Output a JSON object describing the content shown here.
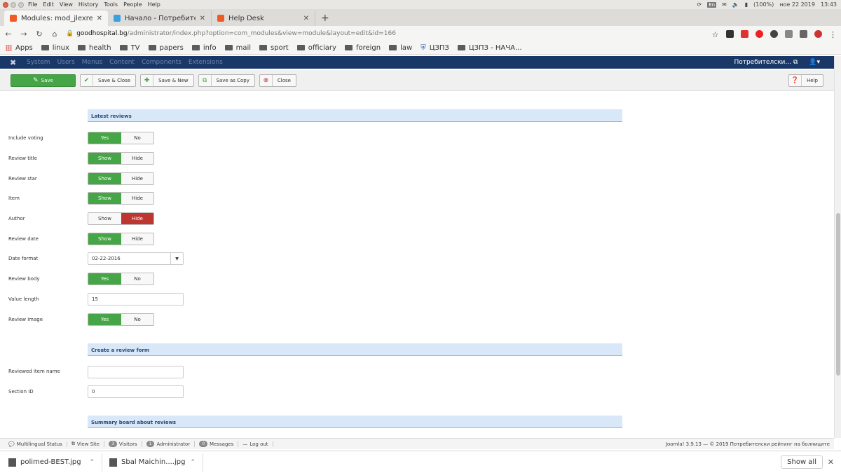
{
  "os": {
    "menu": [
      "File",
      "Edit",
      "View",
      "History",
      "Tools",
      "People",
      "Help"
    ],
    "tray_lang": "En",
    "battery": "(100%)",
    "date": "ное 22 2019",
    "time": "13:43"
  },
  "tabs": [
    {
      "label": "Modules: mod_jlexreview",
      "active": true
    },
    {
      "label": "Начало - Потребителски",
      "active": false
    },
    {
      "label": "Help Desk",
      "active": false
    }
  ],
  "address": {
    "host": "goodhospital.bg",
    "path": "/administrator/index.php?option=com_modules&view=module&layout=edit&id=166"
  },
  "bookmarks": [
    "Apps",
    "linux",
    "health",
    "TV",
    "papers",
    "info",
    "mail",
    "sport",
    "officiary",
    "foreign",
    "law",
    "ЦЗПЗ",
    "ЦЗПЗ - НАЧА..."
  ],
  "joomla_nav": {
    "items": [
      "System",
      "Users",
      "Menus",
      "Content",
      "Components",
      "Extensions"
    ],
    "site_link": "Потребителски... ⧉",
    "user_icon": "user-icon"
  },
  "toolbar": {
    "save": "Save",
    "save_close": "Save & Close",
    "save_new": "Save & New",
    "save_copy": "Save as Copy",
    "close": "Close",
    "help": "Help"
  },
  "sections": {
    "latest": "Latest reviews",
    "create": "Create a review form",
    "summary": "Summary board about reviews"
  },
  "fields": {
    "include_voting": {
      "label": "Include voting",
      "on": "Yes",
      "off": "No",
      "value": "on"
    },
    "review_title": {
      "label": "Review title",
      "on": "Show",
      "off": "Hide",
      "value": "on"
    },
    "review_star": {
      "label": "Review star",
      "on": "Show",
      "off": "Hide",
      "value": "on"
    },
    "item": {
      "label": "Item",
      "on": "Show",
      "off": "Hide",
      "value": "on"
    },
    "author": {
      "label": "Author",
      "on": "Show",
      "off": "Hide",
      "value": "off"
    },
    "review_date": {
      "label": "Review date",
      "on": "Show",
      "off": "Hide",
      "value": "on"
    },
    "date_format": {
      "label": "Date format",
      "value": "02-22-2016"
    },
    "review_body": {
      "label": "Review body",
      "on": "Yes",
      "off": "No",
      "value": "on"
    },
    "value_length": {
      "label": "Value length",
      "value": "15"
    },
    "review_image": {
      "label": "Review image",
      "on": "Yes",
      "off": "No",
      "value": "on"
    },
    "reviewed_item_name": {
      "label": "Reviewed item name",
      "value": ""
    },
    "section_id": {
      "label": "Section ID",
      "value": "0"
    }
  },
  "statusbar": {
    "multilingual": "Multilingual Status",
    "view_site": "View Site",
    "visitors_count": "3",
    "visitors": "Visitors",
    "admin_count": "1",
    "admin": "Administrator",
    "messages_count": "0",
    "messages": "Messages",
    "logout": "Log out",
    "footer": "Joomla! 3.9.13 — © 2019 Потребителски рейтинг на болниците"
  },
  "downloads": {
    "items": [
      "polimed-BEST.jpg",
      "Sbal Maichin....jpg"
    ],
    "show_all": "Show all"
  }
}
